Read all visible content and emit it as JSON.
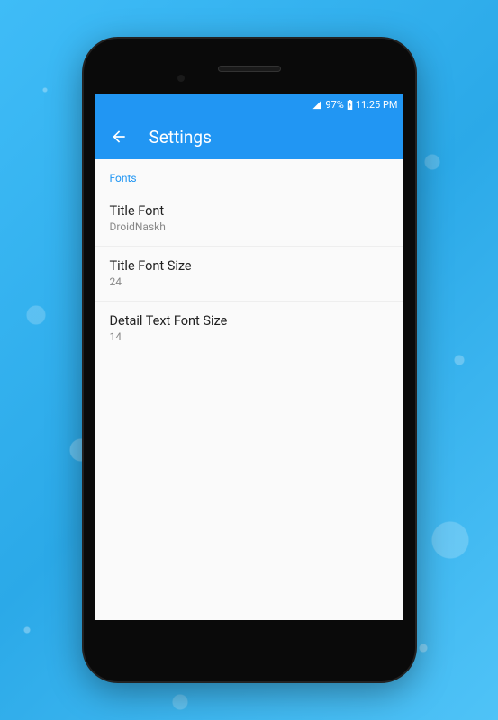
{
  "statusbar": {
    "battery_percent": "97%",
    "time": "11:25 PM"
  },
  "appbar": {
    "title": "Settings"
  },
  "section": {
    "header": "Fonts",
    "items": [
      {
        "title": "Title Font",
        "value": "DroidNaskh"
      },
      {
        "title": "Title Font Size",
        "value": "24"
      },
      {
        "title": "Detail Text Font Size",
        "value": "14"
      }
    ]
  }
}
